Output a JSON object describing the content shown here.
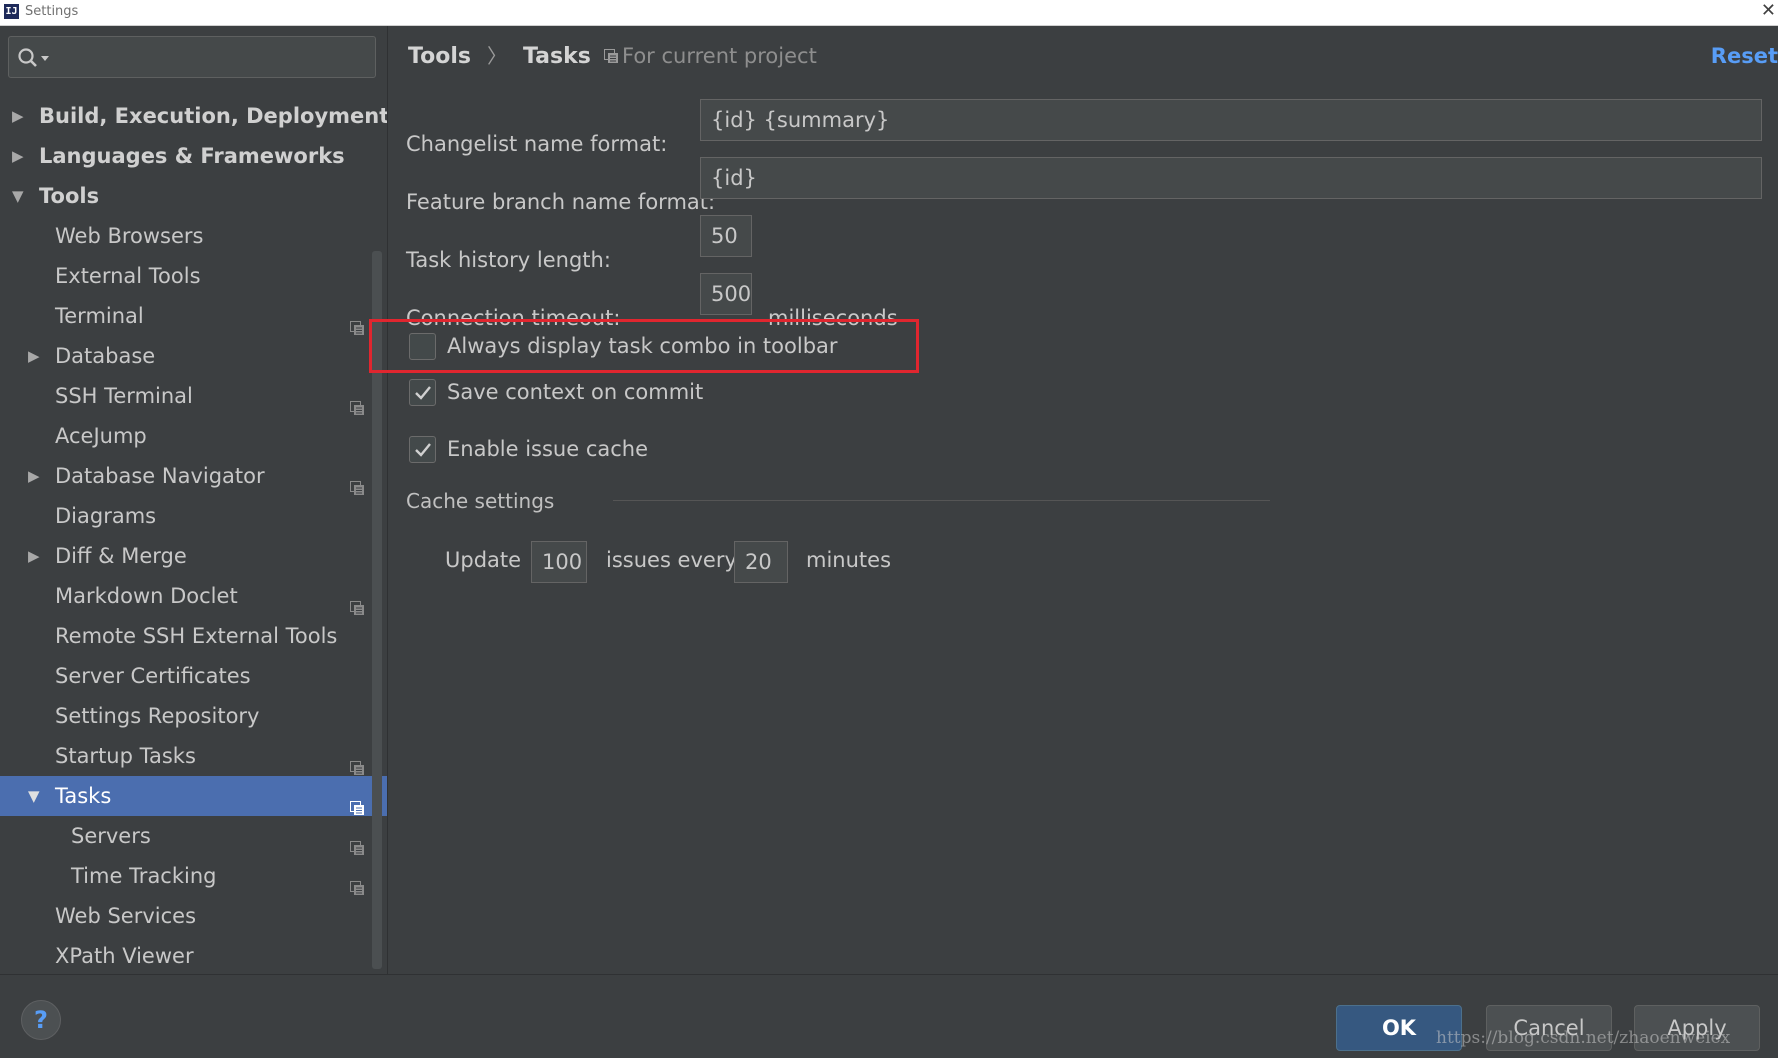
{
  "window": {
    "title": "Settings",
    "app_icon_text": "IJ"
  },
  "sidebar": {
    "search": {
      "value": "",
      "icon": "search-icon"
    },
    "items": [
      {
        "label": "Build, Execution, Deployment",
        "level": 0,
        "arrow": "collapsed",
        "bold": true,
        "project_icon": false,
        "selected": false
      },
      {
        "label": "Languages & Frameworks",
        "level": 0,
        "arrow": "collapsed",
        "bold": true,
        "project_icon": false,
        "selected": false
      },
      {
        "label": "Tools",
        "level": 0,
        "arrow": "expanded",
        "bold": true,
        "project_icon": false,
        "selected": false
      },
      {
        "label": "Web Browsers",
        "level": 1,
        "arrow": "none",
        "bold": false,
        "project_icon": false,
        "selected": false
      },
      {
        "label": "External Tools",
        "level": 1,
        "arrow": "none",
        "bold": false,
        "project_icon": false,
        "selected": false
      },
      {
        "label": "Terminal",
        "level": 1,
        "arrow": "none",
        "bold": false,
        "project_icon": true,
        "selected": false
      },
      {
        "label": "Database",
        "level": 1,
        "arrow": "collapsed",
        "bold": false,
        "project_icon": false,
        "selected": false
      },
      {
        "label": "SSH Terminal",
        "level": 1,
        "arrow": "none",
        "bold": false,
        "project_icon": true,
        "selected": false
      },
      {
        "label": "AceJump",
        "level": 1,
        "arrow": "none",
        "bold": false,
        "project_icon": false,
        "selected": false
      },
      {
        "label": "Database Navigator",
        "level": 1,
        "arrow": "collapsed",
        "bold": false,
        "project_icon": true,
        "selected": false
      },
      {
        "label": "Diagrams",
        "level": 1,
        "arrow": "none",
        "bold": false,
        "project_icon": false,
        "selected": false
      },
      {
        "label": "Diff & Merge",
        "level": 1,
        "arrow": "collapsed",
        "bold": false,
        "project_icon": false,
        "selected": false
      },
      {
        "label": "Markdown Doclet",
        "level": 1,
        "arrow": "none",
        "bold": false,
        "project_icon": true,
        "selected": false
      },
      {
        "label": "Remote SSH External Tools",
        "level": 1,
        "arrow": "none",
        "bold": false,
        "project_icon": false,
        "selected": false
      },
      {
        "label": "Server Certificates",
        "level": 1,
        "arrow": "none",
        "bold": false,
        "project_icon": false,
        "selected": false
      },
      {
        "label": "Settings Repository",
        "level": 1,
        "arrow": "none",
        "bold": false,
        "project_icon": false,
        "selected": false
      },
      {
        "label": "Startup Tasks",
        "level": 1,
        "arrow": "none",
        "bold": false,
        "project_icon": true,
        "selected": false
      },
      {
        "label": "Tasks",
        "level": 1,
        "arrow": "expanded",
        "bold": false,
        "project_icon": true,
        "selected": true
      },
      {
        "label": "Servers",
        "level": 2,
        "arrow": "none",
        "bold": false,
        "project_icon": true,
        "selected": false
      },
      {
        "label": "Time Tracking",
        "level": 2,
        "arrow": "none",
        "bold": false,
        "project_icon": true,
        "selected": false
      },
      {
        "label": "Web Services",
        "level": 1,
        "arrow": "none",
        "bold": false,
        "project_icon": false,
        "selected": false
      },
      {
        "label": "XPath Viewer",
        "level": 1,
        "arrow": "none",
        "bold": false,
        "project_icon": false,
        "selected": false
      }
    ]
  },
  "header": {
    "breadcrumb": [
      "Tools",
      "Tasks"
    ],
    "breadcrumb_separator": "〉",
    "scope": "For current project",
    "reset_label": "Reset"
  },
  "form": {
    "changelist": {
      "label": "Changelist name format:",
      "value": "{id} {summary}"
    },
    "feature_branch": {
      "label": "Feature branch name format:",
      "value": "{id}"
    },
    "history": {
      "label": "Task history length:",
      "value": "50"
    },
    "timeout": {
      "label": "Connection timeout:",
      "value": "500",
      "unit": "milliseconds"
    },
    "checkboxes": {
      "always_display": {
        "label": "Always display task combo in toolbar",
        "checked": false
      },
      "save_context": {
        "label": "Save context on commit",
        "checked": true
      },
      "enable_cache": {
        "label": "Enable issue cache",
        "checked": true
      }
    },
    "cache": {
      "section_title": "Cache settings",
      "update_label": "Update",
      "update_value": "100",
      "issues_every_label": "issues every",
      "minutes_value": "20",
      "minutes_label": "minutes"
    }
  },
  "footer": {
    "help_label": "?",
    "ok_label": "OK",
    "cancel_label": "Cancel",
    "apply_label": "Apply",
    "watermark": "https://blog.csdn.net/zhaoenweiex"
  },
  "colors": {
    "background": "#3c3f41",
    "selection": "#4b6eaf",
    "accent_link": "#589df6",
    "highlight_box": "#e0262f",
    "ok_button": "#365880"
  }
}
